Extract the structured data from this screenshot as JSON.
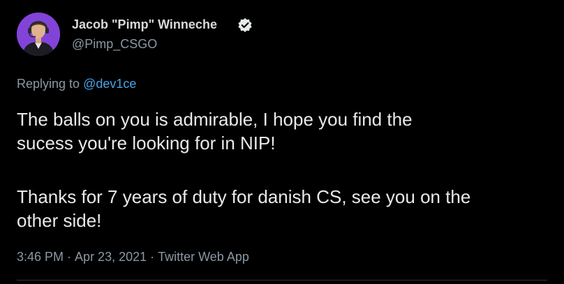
{
  "tweet": {
    "author": {
      "name": "Jacob \"Pimp\" Winneche",
      "handle": "@Pimp_CSGO",
      "verified_icon": "verified-badge-icon",
      "avatar_bg": "#7a3bd1"
    },
    "reply": {
      "prefix": "Replying to",
      "to": "@dev1ce"
    },
    "text_lines": [
      "The balls on you is admirable, I hope you find the",
      "sucess you're looking for in NIP!",
      "Thanks for 7 years of duty for danish CS, see you on the",
      "other side!"
    ],
    "meta": {
      "time": "3:46 PM",
      "separator": "·",
      "date": "Apr 23, 2021",
      "source": "Twitter Web App"
    }
  },
  "colors": {
    "background": "#000000",
    "primary_text": "#e7e9ea",
    "secondary_text": "#8b98a5",
    "link": "#4aa3e8"
  }
}
